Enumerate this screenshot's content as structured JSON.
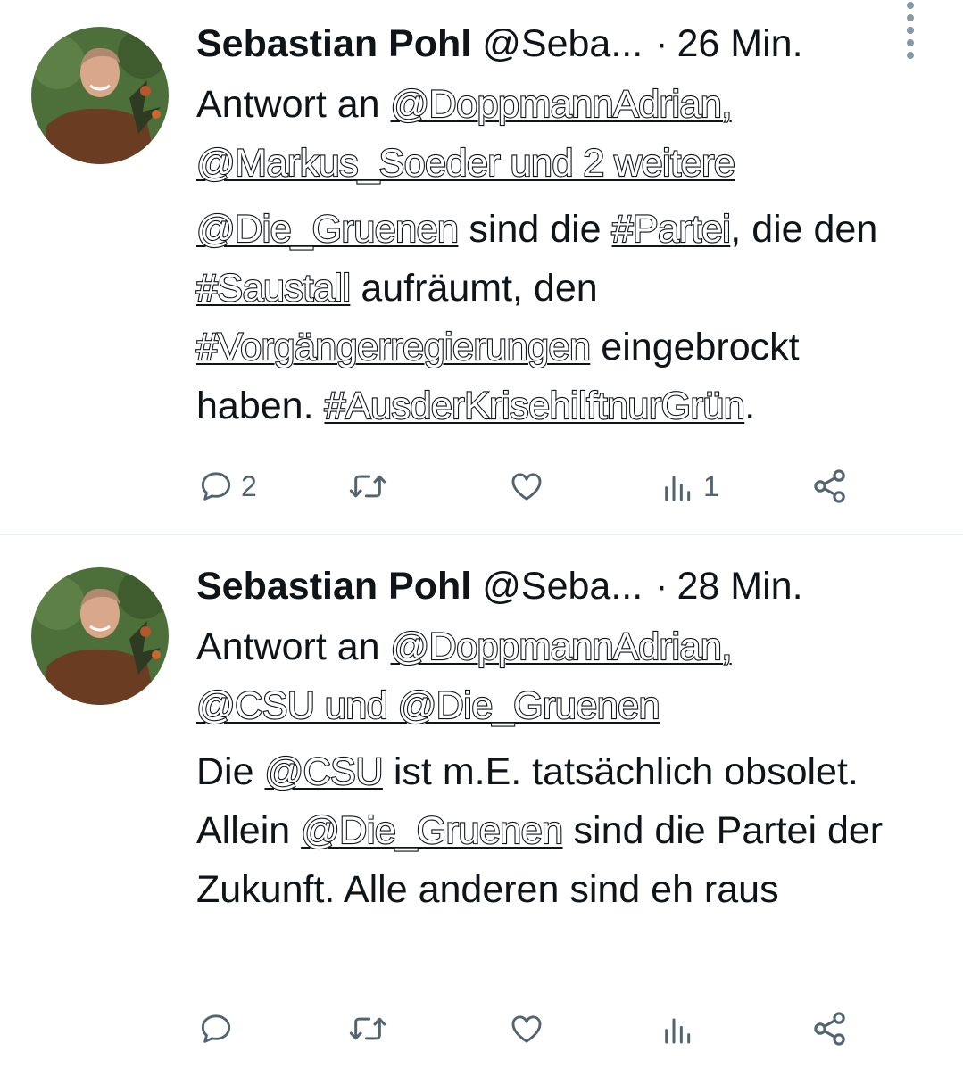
{
  "tweets": [
    {
      "name": "Sebastian Pohl",
      "handle": "@Seba...",
      "separator": "·",
      "time": "26 Min.",
      "replying_prefix": "Antwort an",
      "replying_line1": "@DoppmannAdrian,",
      "replying_line2": "@Markus_Soeder und 2 weitere",
      "text": {
        "m1": "@Die_Gruenen",
        "t1": " sind die ",
        "m2": "#Partei",
        "t2": ", die den ",
        "m3": "#Saustall",
        "t3": " aufräumt, den ",
        "m4": "#Vorgängerregierungen",
        "t4": " eingebrockt haben. ",
        "m5": "#AusderKrisehilftnurGrün",
        "t5": "."
      },
      "counts": {
        "replies": "2",
        "retweets": "",
        "likes": "",
        "views": "1"
      }
    },
    {
      "name": "Sebastian Pohl",
      "handle": "@Seba...",
      "separator": "·",
      "time": "28 Min.",
      "replying_prefix": "Antwort an",
      "replying_line1": "@DoppmannAdrian,",
      "replying_line2": "@CSU und @Die_Gruenen",
      "text": {
        "t0": "Die ",
        "m1": "@CSU",
        "t1": " ist m.E. tatsächlich obsolet.  Allein ",
        "m2": "@Die_Gruenen",
        "t2": " sind die Partei der Zukunft. Alle anderen sind eh raus"
      },
      "counts": {
        "replies": "",
        "retweets": "",
        "likes": "",
        "views": ""
      }
    }
  ],
  "icons": {
    "reply": "speech-bubble-icon",
    "retweet": "retweet-arrows-icon",
    "like": "heart-icon",
    "views": "bar-chart-icon",
    "share": "share-icon",
    "more": "vertical-ellipsis-icon"
  },
  "colors": {
    "text": "#0f1419",
    "icon": "#536471",
    "divider": "#e6ecf0"
  }
}
